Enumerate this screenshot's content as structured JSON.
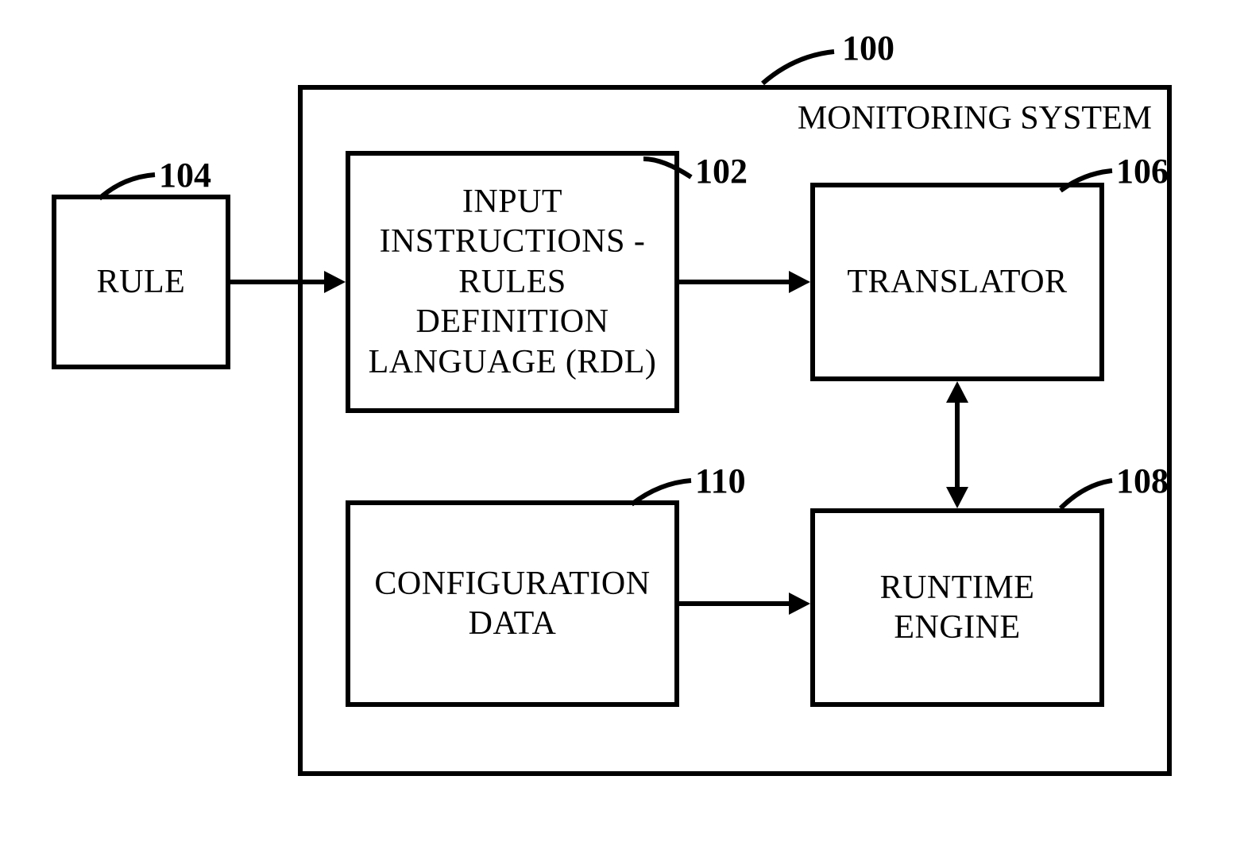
{
  "container": {
    "title": "MONITORING SYSTEM",
    "ref": "100"
  },
  "boxes": {
    "rule": {
      "label": "RULE",
      "ref": "104"
    },
    "rdl": {
      "label": "INPUT INSTRUCTIONS - RULES DEFINITION LANGUAGE (RDL)",
      "ref": "102"
    },
    "translator": {
      "label": "TRANSLATOR",
      "ref": "106"
    },
    "config": {
      "label": "CONFIGURATION DATA",
      "ref": "110"
    },
    "runtime": {
      "label": "RUNTIME ENGINE",
      "ref": "108"
    }
  }
}
